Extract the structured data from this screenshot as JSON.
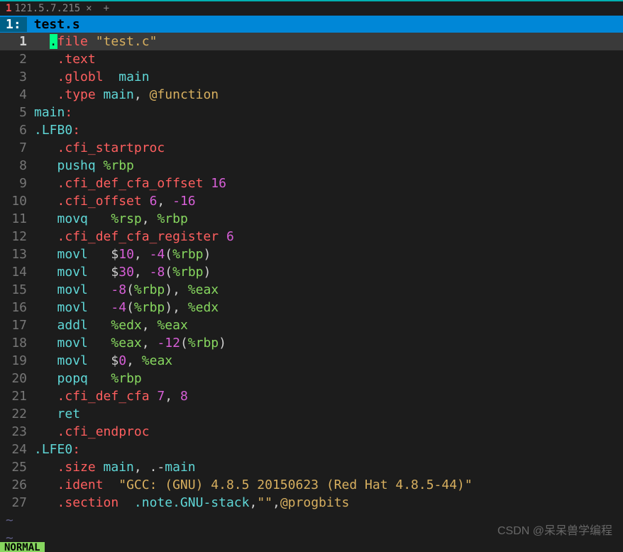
{
  "tab": {
    "indicator": "1",
    "title": "121.5.7.215",
    "plus": "+"
  },
  "buffer": {
    "num": "1:",
    "name": "test.s"
  },
  "lines": [
    {
      "n": 1,
      "current": true,
      "tokens": [
        {
          "t": "  ",
          "c": "white"
        },
        {
          "t": ".",
          "c": "cursor"
        },
        {
          "t": "file ",
          "c": "red"
        },
        {
          "t": "\"test.c\"",
          "c": "yellow"
        }
      ]
    },
    {
      "n": 2,
      "tokens": [
        {
          "t": "   ",
          "c": "white"
        },
        {
          "t": ".text",
          "c": "red"
        }
      ]
    },
    {
      "n": 3,
      "tokens": [
        {
          "t": "   ",
          "c": "white"
        },
        {
          "t": ".globl",
          "c": "red"
        },
        {
          "t": "  ",
          "c": "white"
        },
        {
          "t": "main",
          "c": "cyan"
        }
      ]
    },
    {
      "n": 4,
      "tokens": [
        {
          "t": "   ",
          "c": "white"
        },
        {
          "t": ".type",
          "c": "red"
        },
        {
          "t": " ",
          "c": "white"
        },
        {
          "t": "main",
          "c": "cyan"
        },
        {
          "t": ", ",
          "c": "white"
        },
        {
          "t": "@function",
          "c": "yellow"
        }
      ]
    },
    {
      "n": 5,
      "tokens": [
        {
          "t": "main",
          "c": "cyan"
        },
        {
          "t": ":",
          "c": "red"
        }
      ]
    },
    {
      "n": 6,
      "tokens": [
        {
          "t": ".LFB0",
          "c": "cyan"
        },
        {
          "t": ":",
          "c": "red"
        }
      ]
    },
    {
      "n": 7,
      "tokens": [
        {
          "t": "   ",
          "c": "white"
        },
        {
          "t": ".cfi_startproc",
          "c": "red"
        }
      ]
    },
    {
      "n": 8,
      "tokens": [
        {
          "t": "   ",
          "c": "white"
        },
        {
          "t": "pushq",
          "c": "cyan"
        },
        {
          "t": " ",
          "c": "white"
        },
        {
          "t": "%rbp",
          "c": "green"
        }
      ]
    },
    {
      "n": 9,
      "tokens": [
        {
          "t": "   ",
          "c": "white"
        },
        {
          "t": ".cfi_def_cfa_offset",
          "c": "red"
        },
        {
          "t": " ",
          "c": "white"
        },
        {
          "t": "16",
          "c": "magenta"
        }
      ]
    },
    {
      "n": 10,
      "tokens": [
        {
          "t": "   ",
          "c": "white"
        },
        {
          "t": ".cfi_offset",
          "c": "red"
        },
        {
          "t": " ",
          "c": "white"
        },
        {
          "t": "6",
          "c": "magenta"
        },
        {
          "t": ", ",
          "c": "white"
        },
        {
          "t": "-16",
          "c": "magenta"
        }
      ]
    },
    {
      "n": 11,
      "tokens": [
        {
          "t": "   ",
          "c": "white"
        },
        {
          "t": "movq",
          "c": "cyan"
        },
        {
          "t": "   ",
          "c": "white"
        },
        {
          "t": "%rsp",
          "c": "green"
        },
        {
          "t": ", ",
          "c": "white"
        },
        {
          "t": "%rbp",
          "c": "green"
        }
      ]
    },
    {
      "n": 12,
      "tokens": [
        {
          "t": "   ",
          "c": "white"
        },
        {
          "t": ".cfi_def_cfa_register",
          "c": "red"
        },
        {
          "t": " ",
          "c": "white"
        },
        {
          "t": "6",
          "c": "magenta"
        }
      ]
    },
    {
      "n": 13,
      "tokens": [
        {
          "t": "   ",
          "c": "white"
        },
        {
          "t": "movl",
          "c": "cyan"
        },
        {
          "t": "   $",
          "c": "white"
        },
        {
          "t": "10",
          "c": "magenta"
        },
        {
          "t": ", ",
          "c": "white"
        },
        {
          "t": "-4",
          "c": "magenta"
        },
        {
          "t": "(",
          "c": "white"
        },
        {
          "t": "%rbp",
          "c": "green"
        },
        {
          "t": ")",
          "c": "white"
        }
      ]
    },
    {
      "n": 14,
      "tokens": [
        {
          "t": "   ",
          "c": "white"
        },
        {
          "t": "movl",
          "c": "cyan"
        },
        {
          "t": "   $",
          "c": "white"
        },
        {
          "t": "30",
          "c": "magenta"
        },
        {
          "t": ", ",
          "c": "white"
        },
        {
          "t": "-8",
          "c": "magenta"
        },
        {
          "t": "(",
          "c": "white"
        },
        {
          "t": "%rbp",
          "c": "green"
        },
        {
          "t": ")",
          "c": "white"
        }
      ]
    },
    {
      "n": 15,
      "tokens": [
        {
          "t": "   ",
          "c": "white"
        },
        {
          "t": "movl",
          "c": "cyan"
        },
        {
          "t": "   ",
          "c": "white"
        },
        {
          "t": "-8",
          "c": "magenta"
        },
        {
          "t": "(",
          "c": "white"
        },
        {
          "t": "%rbp",
          "c": "green"
        },
        {
          "t": "), ",
          "c": "white"
        },
        {
          "t": "%eax",
          "c": "green"
        }
      ]
    },
    {
      "n": 16,
      "tokens": [
        {
          "t": "   ",
          "c": "white"
        },
        {
          "t": "movl",
          "c": "cyan"
        },
        {
          "t": "   ",
          "c": "white"
        },
        {
          "t": "-4",
          "c": "magenta"
        },
        {
          "t": "(",
          "c": "white"
        },
        {
          "t": "%rbp",
          "c": "green"
        },
        {
          "t": "), ",
          "c": "white"
        },
        {
          "t": "%edx",
          "c": "green"
        }
      ]
    },
    {
      "n": 17,
      "tokens": [
        {
          "t": "   ",
          "c": "white"
        },
        {
          "t": "addl",
          "c": "cyan"
        },
        {
          "t": "   ",
          "c": "white"
        },
        {
          "t": "%edx",
          "c": "green"
        },
        {
          "t": ", ",
          "c": "white"
        },
        {
          "t": "%eax",
          "c": "green"
        }
      ]
    },
    {
      "n": 18,
      "tokens": [
        {
          "t": "   ",
          "c": "white"
        },
        {
          "t": "movl",
          "c": "cyan"
        },
        {
          "t": "   ",
          "c": "white"
        },
        {
          "t": "%eax",
          "c": "green"
        },
        {
          "t": ", ",
          "c": "white"
        },
        {
          "t": "-12",
          "c": "magenta"
        },
        {
          "t": "(",
          "c": "white"
        },
        {
          "t": "%rbp",
          "c": "green"
        },
        {
          "t": ")",
          "c": "white"
        }
      ]
    },
    {
      "n": 19,
      "tokens": [
        {
          "t": "   ",
          "c": "white"
        },
        {
          "t": "movl",
          "c": "cyan"
        },
        {
          "t": "   $",
          "c": "white"
        },
        {
          "t": "0",
          "c": "magenta"
        },
        {
          "t": ", ",
          "c": "white"
        },
        {
          "t": "%eax",
          "c": "green"
        }
      ]
    },
    {
      "n": 20,
      "tokens": [
        {
          "t": "   ",
          "c": "white"
        },
        {
          "t": "popq",
          "c": "cyan"
        },
        {
          "t": "   ",
          "c": "white"
        },
        {
          "t": "%rbp",
          "c": "green"
        }
      ]
    },
    {
      "n": 21,
      "tokens": [
        {
          "t": "   ",
          "c": "white"
        },
        {
          "t": ".cfi_def_cfa",
          "c": "red"
        },
        {
          "t": " ",
          "c": "white"
        },
        {
          "t": "7",
          "c": "magenta"
        },
        {
          "t": ", ",
          "c": "white"
        },
        {
          "t": "8",
          "c": "magenta"
        }
      ]
    },
    {
      "n": 22,
      "tokens": [
        {
          "t": "   ",
          "c": "white"
        },
        {
          "t": "ret",
          "c": "cyan"
        }
      ]
    },
    {
      "n": 23,
      "tokens": [
        {
          "t": "   ",
          "c": "white"
        },
        {
          "t": ".cfi_endproc",
          "c": "red"
        }
      ]
    },
    {
      "n": 24,
      "tokens": [
        {
          "t": ".LFE0",
          "c": "cyan"
        },
        {
          "t": ":",
          "c": "red"
        }
      ]
    },
    {
      "n": 25,
      "tokens": [
        {
          "t": "   ",
          "c": "white"
        },
        {
          "t": ".size",
          "c": "red"
        },
        {
          "t": " ",
          "c": "white"
        },
        {
          "t": "main",
          "c": "cyan"
        },
        {
          "t": ", .-",
          "c": "white"
        },
        {
          "t": "main",
          "c": "cyan"
        }
      ]
    },
    {
      "n": 26,
      "tokens": [
        {
          "t": "   ",
          "c": "white"
        },
        {
          "t": ".ident",
          "c": "red"
        },
        {
          "t": "  ",
          "c": "white"
        },
        {
          "t": "\"GCC: (GNU) 4.8.5 20150623 (Red Hat 4.8.5-44)\"",
          "c": "yellow"
        }
      ]
    },
    {
      "n": 27,
      "tokens": [
        {
          "t": "   ",
          "c": "white"
        },
        {
          "t": ".section",
          "c": "red"
        },
        {
          "t": "  ",
          "c": "white"
        },
        {
          "t": ".note.GNU-stack",
          "c": "cyan"
        },
        {
          "t": ",",
          "c": "white"
        },
        {
          "t": "\"\"",
          "c": "yellow"
        },
        {
          "t": ",",
          "c": "white"
        },
        {
          "t": "@progbits",
          "c": "yellow"
        }
      ]
    }
  ],
  "tildes": [
    "~",
    "~"
  ],
  "watermark": "CSDN @呆呆兽学编程",
  "status": "NORMAL"
}
